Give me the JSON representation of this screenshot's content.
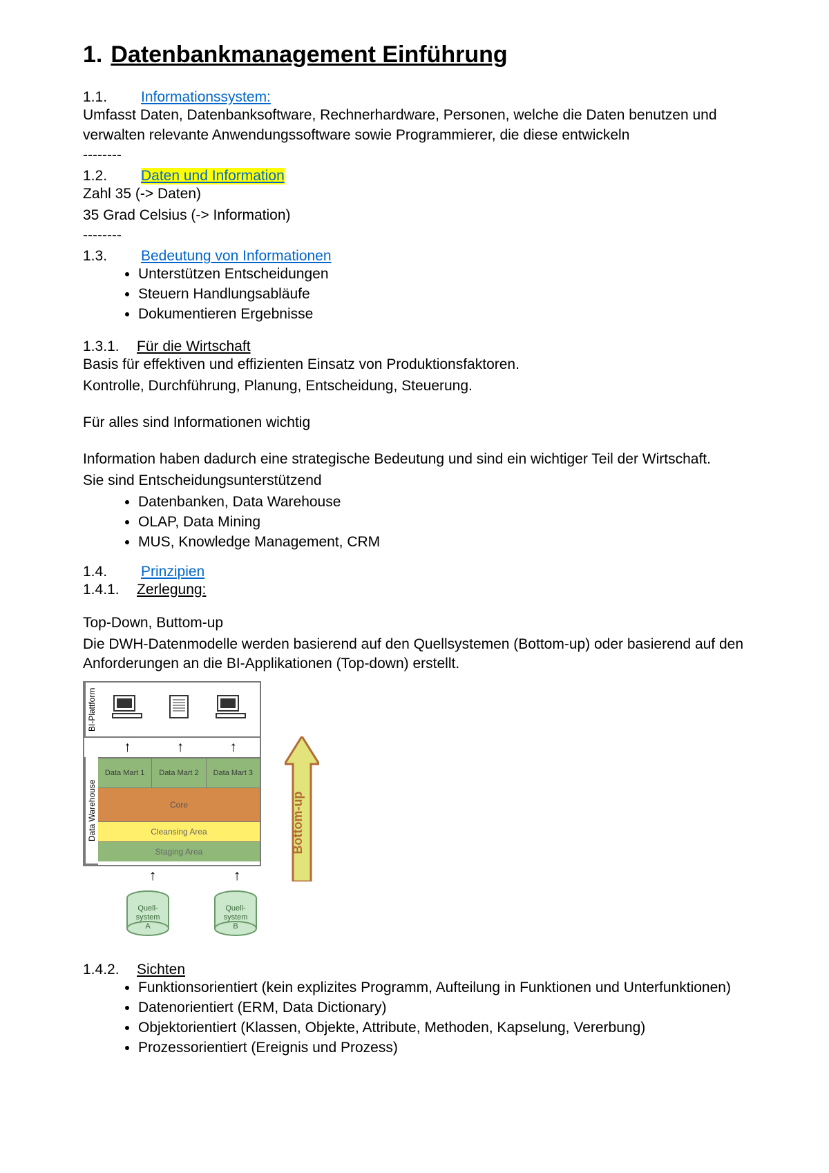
{
  "title": {
    "num": "1.",
    "text": "Datenbankmanagement Einführung"
  },
  "sections": {
    "s11": {
      "num": "1.1.",
      "title": " Informationssystem:",
      "para": "Umfasst Daten, Datenbanksoftware, Rechnerhardware, Personen, welche die Daten benutzen und verwalten relevante Anwendungssoftware sowie Programmierer, die diese entwickeln"
    },
    "dash": "--------",
    "s12": {
      "num": "1.2.",
      "title": " Daten und Information",
      "line1": "Zahl 35 (-> Daten)",
      "line2": "35 Grad Celsius (-> Information)"
    },
    "s13": {
      "num": "1.3.",
      "title": " Bedeutung von Informationen",
      "bullets": [
        "Unterstützen Entscheidungen",
        "Steuern Handlungsabläufe",
        "Dokumentieren Ergebnisse"
      ]
    },
    "s131": {
      "num": "1.3.1.",
      "title": "Für die Wirtschaft",
      "p1": "Basis für effektiven und effizienten Einsatz von Produktionsfaktoren.",
      "p2": "Kontrolle, Durchführung, Planung, Entscheidung, Steuerung.",
      "p3": "Für alles sind Informationen wichtig",
      "p4": "Information haben dadurch eine strategische Bedeutung und sind ein wichtiger Teil der Wirtschaft.",
      "p5": "Sie sind Entscheidungsunterstützend",
      "bullets": [
        "Datenbanken, Data Warehouse",
        "OLAP, Data Mining",
        "MUS, Knowledge Management, CRM"
      ]
    },
    "s14": {
      "num": "1.4.",
      "title": "Prinzipien"
    },
    "s141": {
      "num": "1.4.1.",
      "title": "Zerlegung: ",
      "p1": "Top-Down, Buttom-up",
      "p2": "Die DWH-Datenmodelle werden basierend auf den Quellsystemen (Bottom-up) oder basierend auf den Anforderungen an die BI-Applikationen (Top-down) erstellt."
    },
    "s142": {
      "num": "1.4.2.",
      "title": "Sichten",
      "bullets": [
        "Funktionsorientiert (kein explizites Programm, Aufteilung in Funktionen und Unterfunktionen)",
        "Datenorientiert (ERM, Data Dictionary)",
        "Objektorientiert (Klassen, Objekte, Attribute, Methoden, Kapselung, Vererbung)",
        "Prozessorientiert (Ereignis und Prozess)"
      ]
    }
  },
  "diagram": {
    "vlabel_top": "BI-Plattform",
    "vlabel_mid": "Data Warehouse",
    "marts": [
      "Data Mart 1",
      "Data Mart 2",
      "Data Mart 3"
    ],
    "core": "Core",
    "cleansing": "Cleansing Area",
    "staging": "Staging Area",
    "source_a": "Quell-\nsystem\nA",
    "source_b": "Quell-\nsystem\nB",
    "arrow_label": "Bottom-up"
  }
}
